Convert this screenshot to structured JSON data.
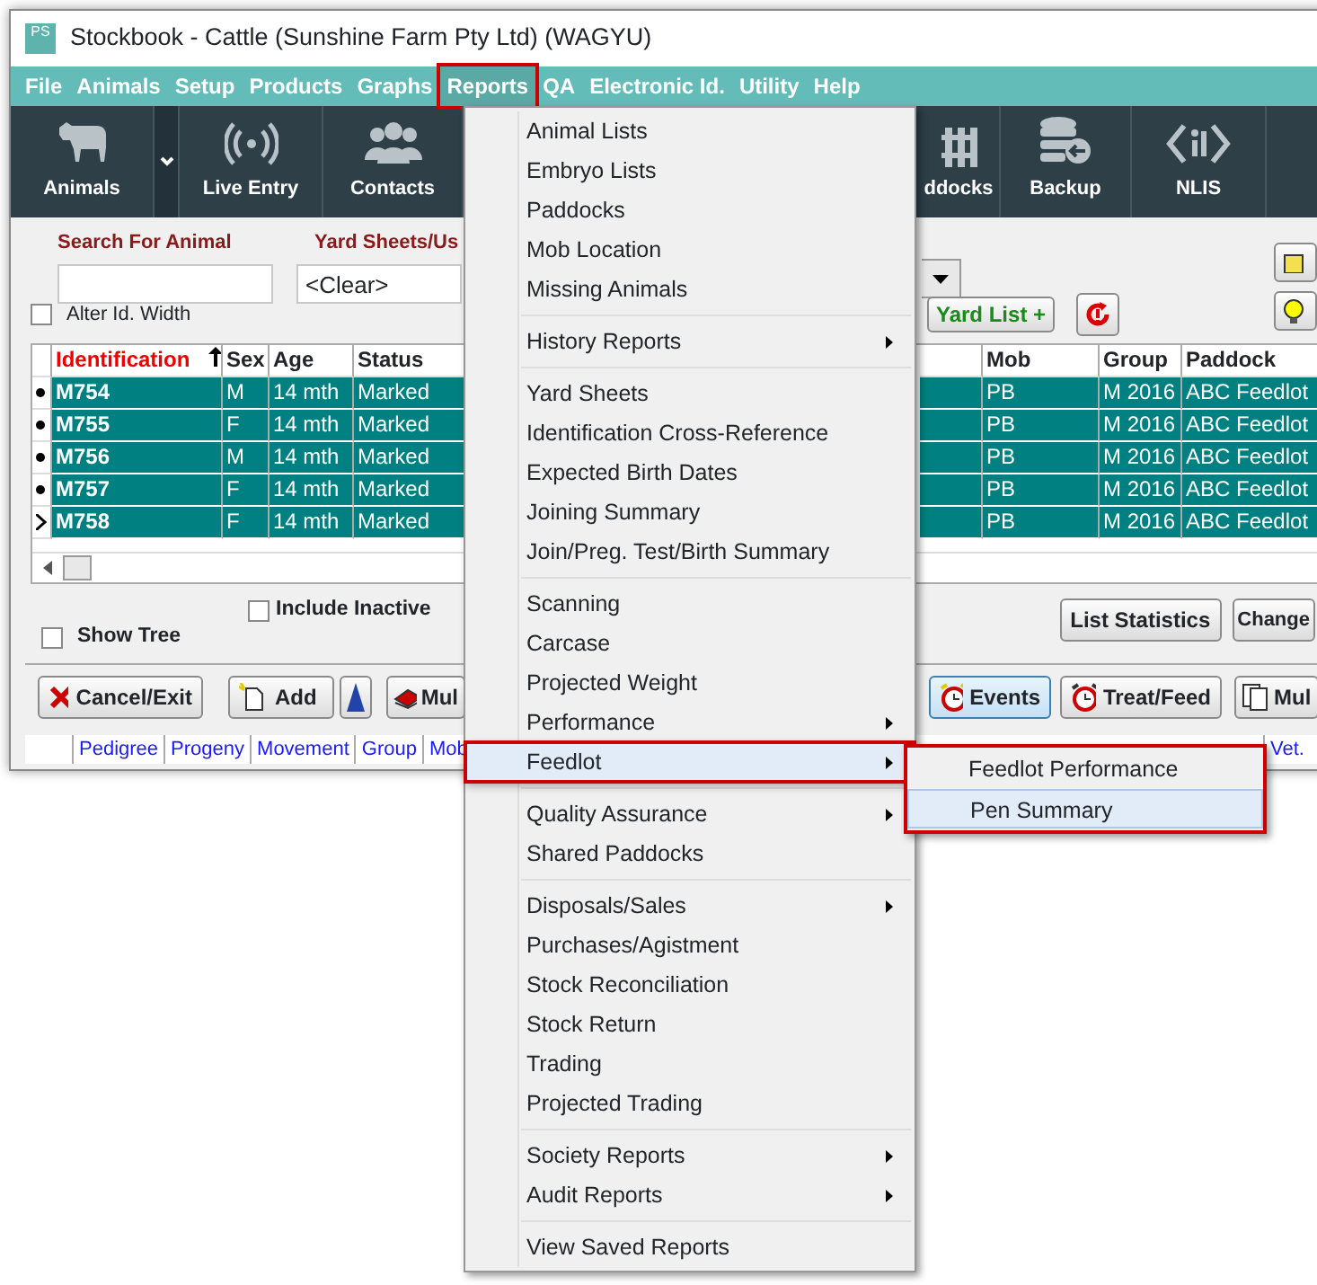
{
  "window": {
    "title": "Stockbook - Cattle (Sunshine Farm Pty Ltd) (WAGYU)",
    "logo": "PS"
  },
  "menu_bar": [
    {
      "label": "File",
      "selected": false
    },
    {
      "label": "Animals",
      "selected": false
    },
    {
      "label": "Setup",
      "selected": false
    },
    {
      "label": "Products",
      "selected": false
    },
    {
      "label": "Graphs",
      "selected": false
    },
    {
      "label": "Reports",
      "selected": true
    },
    {
      "label": "QA",
      "selected": false
    },
    {
      "label": "Electronic Id.",
      "selected": false
    },
    {
      "label": "Utility",
      "selected": false
    },
    {
      "label": "Help",
      "selected": false
    }
  ],
  "toolbar": [
    {
      "label": "Animals",
      "dropdown": true
    },
    {
      "label": "Live Entry",
      "dropdown": false
    },
    {
      "label": "Contacts",
      "dropdown": false
    },
    {
      "label": "ddocks",
      "dropdown": false
    },
    {
      "label": "Backup",
      "dropdown": false
    },
    {
      "label": "NLIS",
      "dropdown": false
    }
  ],
  "search": {
    "label": "Search For Animal"
  },
  "yard_sheets": {
    "label": "Yard Sheets/Us",
    "value": "<Clear>"
  },
  "alter_id_width": {
    "label": "Alter Id. Width",
    "checked": false
  },
  "yard_list_button": "Yard List +",
  "table": {
    "columns": [
      {
        "label": "Identification",
        "sorted": true
      },
      {
        "label": "Sex",
        "sorted": false
      },
      {
        "label": "Age",
        "sorted": false
      },
      {
        "label": "Status",
        "sorted": false
      },
      {
        "label": "Mob",
        "sorted": false
      },
      {
        "label": "Group",
        "sorted": false
      },
      {
        "label": "Paddock",
        "sorted": false
      }
    ],
    "rows": [
      {
        "current": false,
        "selected": true,
        "cells": [
          "M754",
          "M",
          "14 mth",
          "Marked",
          "PB",
          "M 2016",
          "ABC Feedlot"
        ]
      },
      {
        "current": false,
        "selected": true,
        "cells": [
          "M755",
          "F",
          "14 mth",
          "Marked",
          "PB",
          "M 2016",
          "ABC Feedlot"
        ]
      },
      {
        "current": false,
        "selected": true,
        "cells": [
          "M756",
          "M",
          "14 mth",
          "Marked",
          "PB",
          "M 2016",
          "ABC Feedlot"
        ]
      },
      {
        "current": false,
        "selected": true,
        "cells": [
          "M757",
          "F",
          "14 mth",
          "Marked",
          "PB",
          "M 2016",
          "ABC Feedlot"
        ]
      },
      {
        "current": true,
        "selected": true,
        "cells": [
          "M758",
          "F",
          "14 mth",
          "Marked",
          "PB",
          "M 2016",
          "ABC Feedlot"
        ]
      }
    ]
  },
  "include_inactive": {
    "label": "Include Inactive",
    "checked": false
  },
  "show_tree": {
    "label": "Show Tree",
    "checked": false
  },
  "side_buttons": [
    "List Statistics",
    "Change"
  ],
  "action_buttons": [
    {
      "label": "Cancel/Exit",
      "focused": false
    },
    {
      "label": "Add",
      "focused": false
    },
    {
      "label": "Mul",
      "focused": false
    },
    {
      "label": "Events",
      "focused": true
    },
    {
      "label": "Treat/Feed",
      "focused": false
    },
    {
      "label": "Mul",
      "focused": false
    }
  ],
  "links_left": [
    "Pedigree",
    "Progeny",
    "Movement",
    "Group",
    "Mob"
  ],
  "links_right": [
    "Vet."
  ],
  "reports_menu": {
    "items": [
      {
        "kind": "item",
        "label": "Animal Lists",
        "submenu": false,
        "highlighted": false
      },
      {
        "kind": "item",
        "label": "Embryo Lists",
        "submenu": false,
        "highlighted": false
      },
      {
        "kind": "item",
        "label": "Paddocks",
        "submenu": false,
        "highlighted": false
      },
      {
        "kind": "item",
        "label": "Mob Location",
        "submenu": false,
        "highlighted": false
      },
      {
        "kind": "item",
        "label": "Missing Animals",
        "submenu": false,
        "highlighted": false
      },
      {
        "kind": "separator"
      },
      {
        "kind": "item",
        "label": "History Reports",
        "submenu": true,
        "highlighted": false
      },
      {
        "kind": "separator"
      },
      {
        "kind": "item",
        "label": "Yard Sheets",
        "submenu": false,
        "highlighted": false
      },
      {
        "kind": "item",
        "label": "Identification Cross-Reference",
        "submenu": false,
        "highlighted": false
      },
      {
        "kind": "item",
        "label": "Expected Birth Dates",
        "submenu": false,
        "highlighted": false
      },
      {
        "kind": "item",
        "label": "Joining Summary",
        "submenu": false,
        "highlighted": false
      },
      {
        "kind": "item",
        "label": "Join/Preg. Test/Birth Summary",
        "submenu": false,
        "highlighted": false
      },
      {
        "kind": "separator"
      },
      {
        "kind": "item",
        "label": "Scanning",
        "submenu": false,
        "highlighted": false
      },
      {
        "kind": "item",
        "label": "Carcase",
        "submenu": false,
        "highlighted": false
      },
      {
        "kind": "item",
        "label": "Projected Weight",
        "submenu": false,
        "highlighted": false
      },
      {
        "kind": "item",
        "label": "Performance",
        "submenu": true,
        "highlighted": false
      },
      {
        "kind": "item",
        "label": "Feedlot",
        "submenu": true,
        "highlighted": true
      },
      {
        "kind": "separator"
      },
      {
        "kind": "item",
        "label": "Quality Assurance",
        "submenu": true,
        "highlighted": false
      },
      {
        "kind": "item",
        "label": "Shared Paddocks",
        "submenu": false,
        "highlighted": false
      },
      {
        "kind": "separator"
      },
      {
        "kind": "item",
        "label": "Disposals/Sales",
        "submenu": true,
        "highlighted": false
      },
      {
        "kind": "item",
        "label": "Purchases/Agistment",
        "submenu": false,
        "highlighted": false
      },
      {
        "kind": "item",
        "label": "Stock Reconciliation",
        "submenu": false,
        "highlighted": false
      },
      {
        "kind": "item",
        "label": "Stock Return",
        "submenu": false,
        "highlighted": false
      },
      {
        "kind": "item",
        "label": "Trading",
        "submenu": false,
        "highlighted": false
      },
      {
        "kind": "item",
        "label": "Projected Trading",
        "submenu": false,
        "highlighted": false
      },
      {
        "kind": "separator"
      },
      {
        "kind": "item",
        "label": "Society Reports",
        "submenu": true,
        "highlighted": false
      },
      {
        "kind": "item",
        "label": "Audit Reports",
        "submenu": true,
        "highlighted": false
      },
      {
        "kind": "separator"
      },
      {
        "kind": "item",
        "label": "View Saved Reports",
        "submenu": false,
        "highlighted": false
      }
    ]
  },
  "feedlot_submenu": {
    "items": [
      {
        "label": "Feedlot Performance",
        "highlighted": false
      },
      {
        "label": "Pen Summary",
        "highlighted": true
      }
    ]
  }
}
